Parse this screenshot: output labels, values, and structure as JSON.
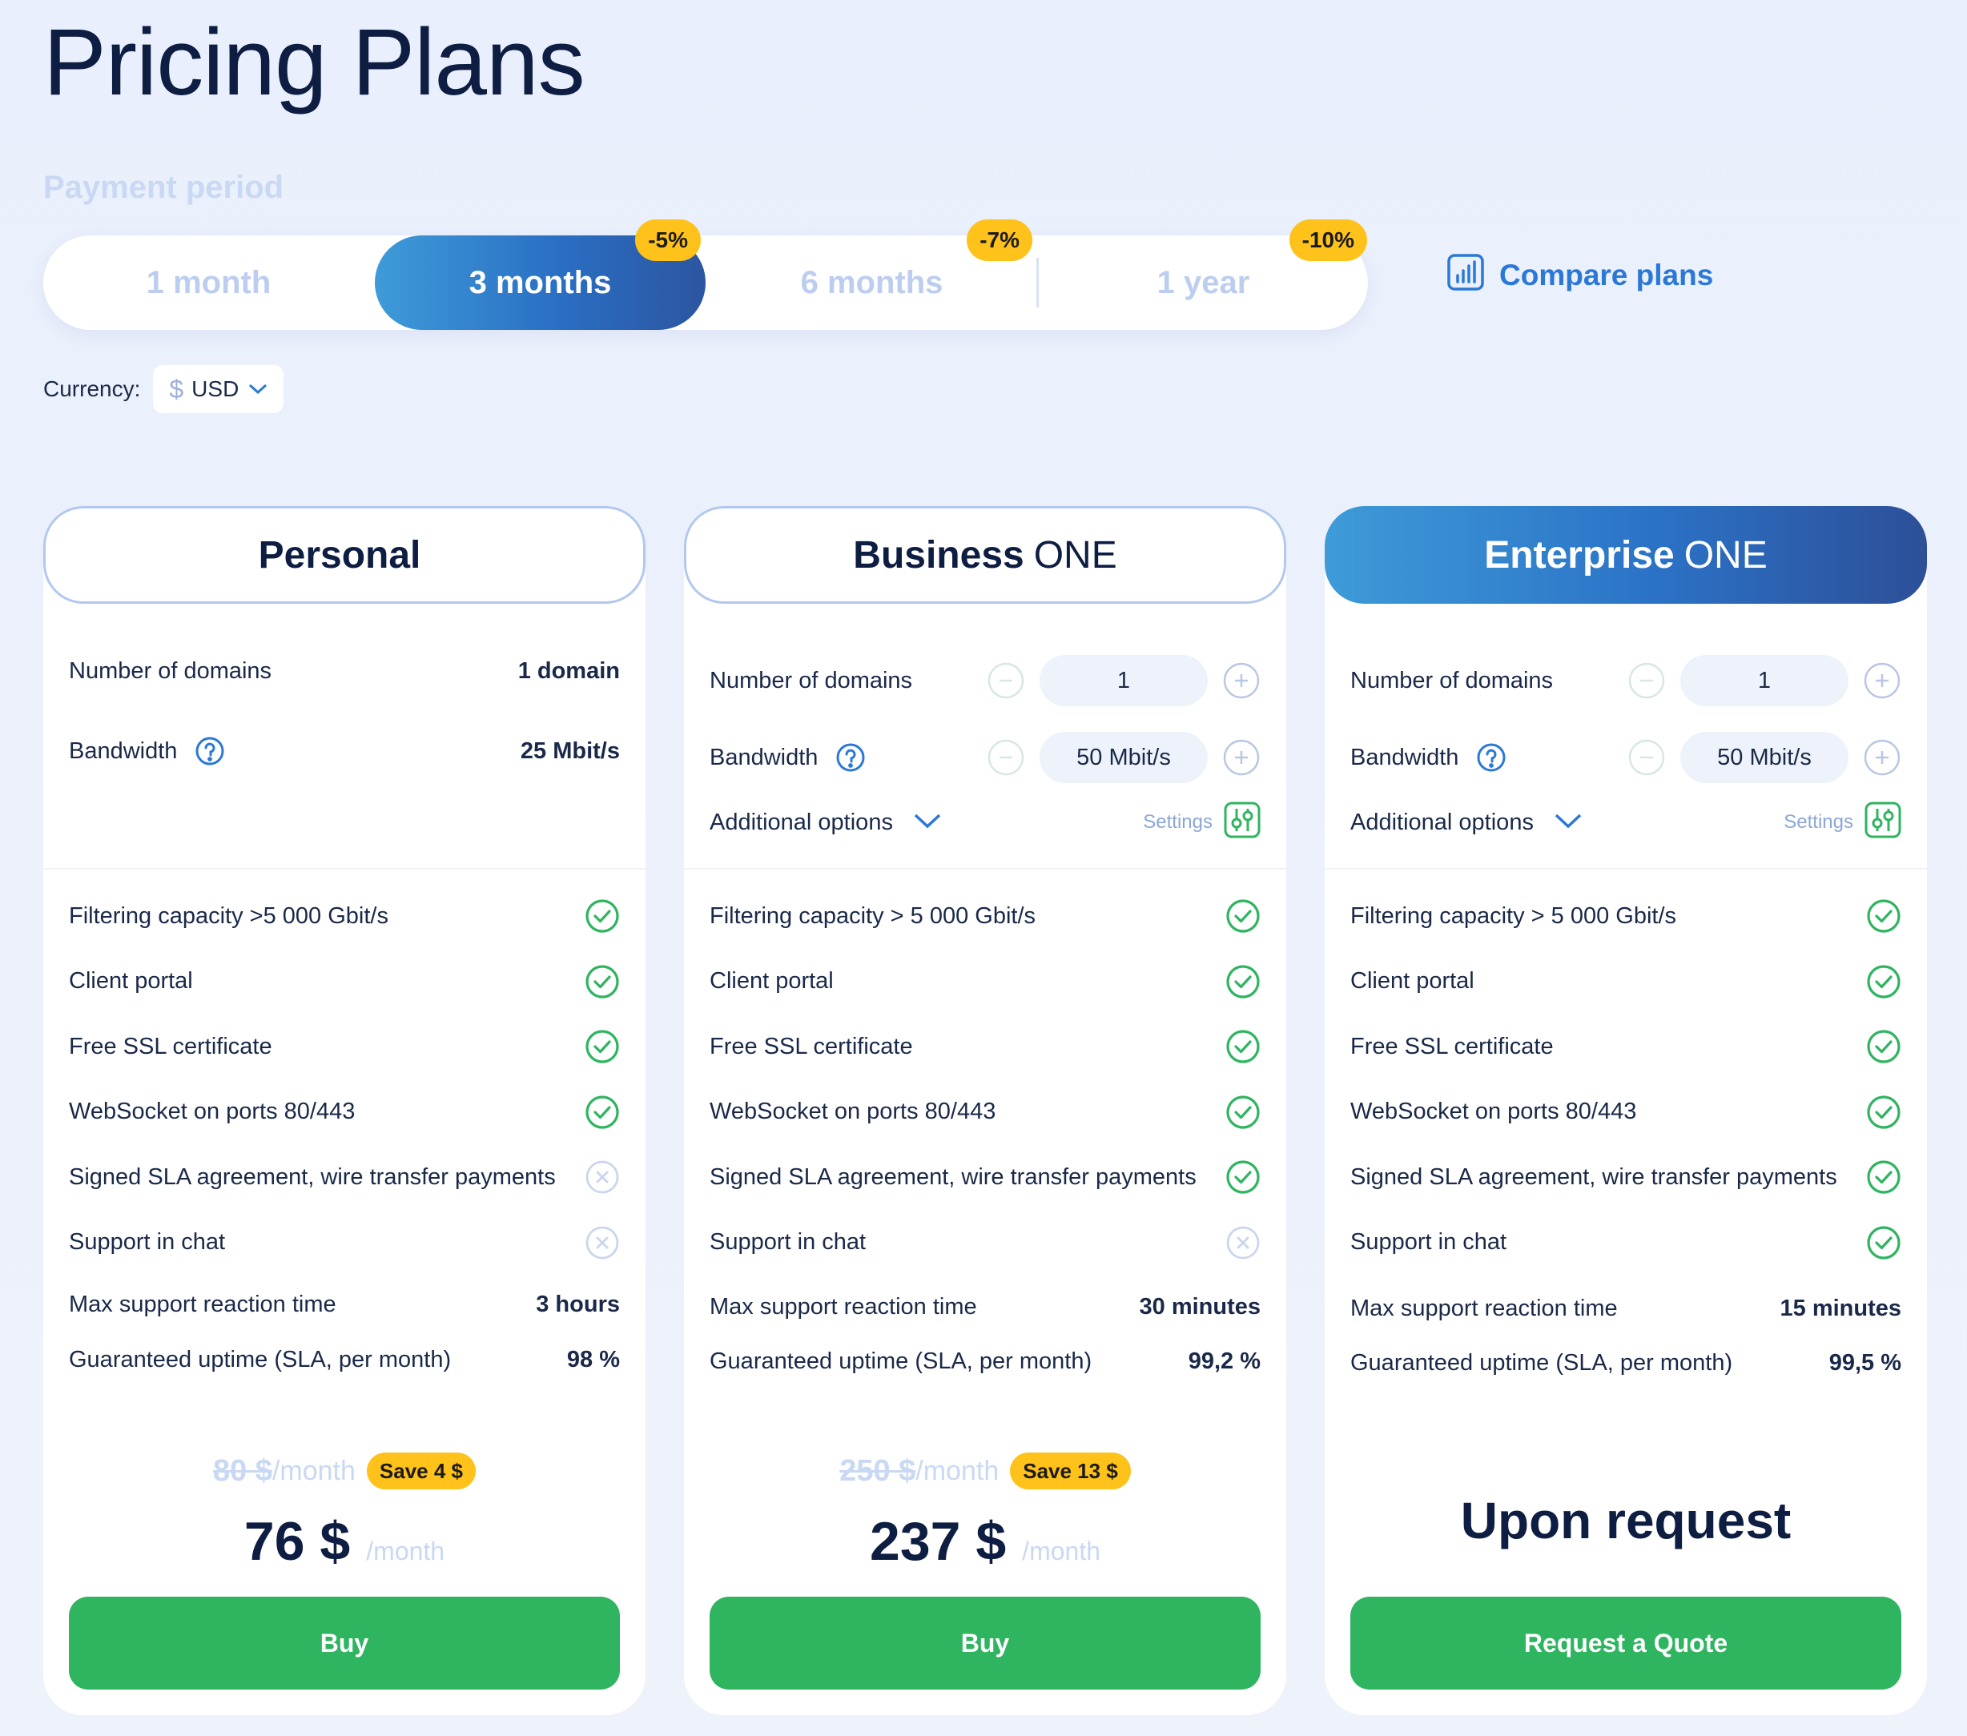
{
  "page": {
    "title": "Pricing Plans"
  },
  "period": {
    "label": "Payment period",
    "tabs": [
      {
        "label": "1 month",
        "badge": ""
      },
      {
        "label": "3 months",
        "badge": "-5%"
      },
      {
        "label": "6 months",
        "badge": "-7%"
      },
      {
        "label": "1 year",
        "badge": "-10%"
      }
    ],
    "selected": "3 months"
  },
  "compare": {
    "label": "Compare plans",
    "icon": "bar-chart-icon"
  },
  "currency": {
    "label": "Currency:",
    "symbol": "$",
    "value": "USD"
  },
  "colors": {
    "accent": "#2b78d6",
    "cta": "#2fb460",
    "badge": "#ffc21a",
    "check": "#2fb460",
    "title": "#0e1d42"
  },
  "plans": [
    {
      "name_bold": "Personal",
      "name_light": "",
      "domains": {
        "label": "Number of domains",
        "value": "1 domain"
      },
      "bandwidth": {
        "label": "Bandwidth",
        "value": "25 Mbit/s"
      },
      "features": [
        {
          "label": "Filtering capacity >5 000 Gbit/s",
          "status": "check"
        },
        {
          "label": "Client portal",
          "status": "check"
        },
        {
          "label": "Free SSL certificate",
          "status": "check"
        },
        {
          "label": "WebSocket on ports 80/443",
          "status": "check"
        },
        {
          "label": "Signed SLA agreement, wire transfer payments",
          "status": "cross"
        },
        {
          "label": "Support in chat",
          "status": "cross"
        }
      ],
      "reaction": {
        "label": "Max support reaction time",
        "value": "3 hours"
      },
      "uptime": {
        "label": "Guaranteed uptime (SLA, per month)",
        "value": "98 %"
      },
      "old_price": "80 $",
      "old_per": "/month",
      "save": "Save 4 $",
      "price": "76 $",
      "per": "/month",
      "cta": "Buy"
    },
    {
      "name_bold": "Business",
      "name_light": "ONE",
      "domains": {
        "label": "Number of domains",
        "value": "1"
      },
      "bandwidth": {
        "label": "Bandwidth",
        "value": "50 Mbit/s"
      },
      "additional": {
        "label": "Additional options",
        "settings": "Settings"
      },
      "features": [
        {
          "label": "Filtering capacity > 5 000 Gbit/s",
          "status": "check"
        },
        {
          "label": "Client portal",
          "status": "check"
        },
        {
          "label": "Free SSL certificate",
          "status": "check"
        },
        {
          "label": "WebSocket on ports 80/443",
          "status": "check"
        },
        {
          "label": "Signed SLA agreement, wire transfer payments",
          "status": "check"
        },
        {
          "label": "Support in chat",
          "status": "cross"
        }
      ],
      "reaction": {
        "label": "Max support reaction time",
        "value": "30 minutes"
      },
      "uptime": {
        "label": "Guaranteed uptime (SLA, per month)",
        "value": "99,2 %"
      },
      "old_price": "250 $",
      "old_per": "/month",
      "save": "Save 13 $",
      "price": "237 $",
      "per": "/month",
      "cta": "Buy"
    },
    {
      "name_bold": "Enterprise",
      "name_light": "ONE",
      "domains": {
        "label": "Number of domains",
        "value": "1"
      },
      "bandwidth": {
        "label": "Bandwidth",
        "value": "50 Mbit/s"
      },
      "additional": {
        "label": "Additional options",
        "settings": "Settings"
      },
      "features": [
        {
          "label": "Filtering capacity > 5 000 Gbit/s",
          "status": "check"
        },
        {
          "label": "Client portal",
          "status": "check"
        },
        {
          "label": "Free SSL certificate",
          "status": "check"
        },
        {
          "label": "WebSocket on ports 80/443",
          "status": "check"
        },
        {
          "label": "Signed SLA agreement, wire transfer payments",
          "status": "check"
        },
        {
          "label": "Support in chat",
          "status": "check"
        }
      ],
      "reaction": {
        "label": "Max support reaction time",
        "value": "15 minutes"
      },
      "uptime": {
        "label": "Guaranteed uptime (SLA, per month)",
        "value": "99,5 %"
      },
      "price_text": "Upon request",
      "cta": "Request a Quote"
    }
  ]
}
